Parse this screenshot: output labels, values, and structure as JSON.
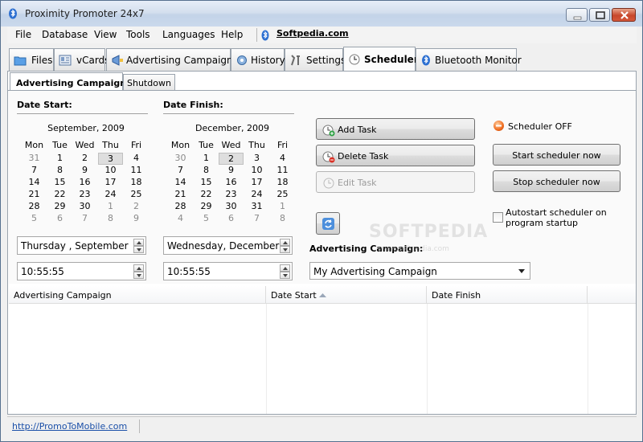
{
  "window": {
    "title": "Proximity Promoter 24x7"
  },
  "menu": {
    "items": [
      "File",
      "Database",
      "View",
      "Tools",
      "Languages",
      "Help"
    ],
    "link": "Softpedia.com"
  },
  "tabs": [
    "Files",
    "vCards",
    "Advertising Campaigns",
    "History",
    "Settings",
    "Scheduler",
    "Bluetooth Monitor"
  ],
  "active_tab": "Scheduler",
  "subtabs": [
    "Advertising Campaigns",
    "Shutdown"
  ],
  "date_start": {
    "label": "Date Start:",
    "month": "September, 2009",
    "weekdays": [
      "Mon",
      "Tue",
      "Wed",
      "Thu",
      "Fri"
    ],
    "rows": [
      [
        "31",
        "1",
        "2",
        "3",
        "4"
      ],
      [
        "7",
        "8",
        "9",
        "10",
        "11"
      ],
      [
        "14",
        "15",
        "16",
        "17",
        "18"
      ],
      [
        "21",
        "22",
        "23",
        "24",
        "25"
      ],
      [
        "28",
        "29",
        "30",
        "1",
        "2"
      ],
      [
        "5",
        "6",
        "7",
        "8",
        "9"
      ]
    ],
    "date_value": "Thursday  , September",
    "time_value": "10:55:55"
  },
  "date_finish": {
    "label": "Date Finish:",
    "month": "December, 2009",
    "weekdays": [
      "Mon",
      "Tue",
      "Wed",
      "Thu",
      "Fri"
    ],
    "rows": [
      [
        "30",
        "1",
        "2",
        "3",
        "4"
      ],
      [
        "7",
        "8",
        "9",
        "10",
        "11"
      ],
      [
        "14",
        "15",
        "16",
        "17",
        "18"
      ],
      [
        "21",
        "22",
        "23",
        "24",
        "25"
      ],
      [
        "28",
        "29",
        "30",
        "31",
        "1"
      ],
      [
        "4",
        "5",
        "6",
        "7",
        "8"
      ]
    ],
    "date_value": "Wednesday,  December",
    "time_value": "10:55:55"
  },
  "tasks": {
    "add": "Add Task",
    "delete": "Delete Task",
    "edit": "Edit Task"
  },
  "scheduler": {
    "status": "Scheduler OFF",
    "start": "Start scheduler now",
    "stop": "Stop scheduler now",
    "autostart": "Autostart scheduler on program startup"
  },
  "campaign": {
    "label": "Advertising Campaign:",
    "selected": "My Advertising Campaign"
  },
  "table": {
    "columns": [
      "Advertising Campaign",
      "Date Start",
      "Date Finish"
    ]
  },
  "status": {
    "link": "http://PromoToMobile.com"
  },
  "watermark": {
    "main": "SOFTPEDIA",
    "sub": "www.softpedia.com"
  },
  "colors": {
    "title_grad": "#d4dfee",
    "close_btn": "#c7472c",
    "link": "#1a4fa8",
    "status_off": "#ef6b1e"
  }
}
